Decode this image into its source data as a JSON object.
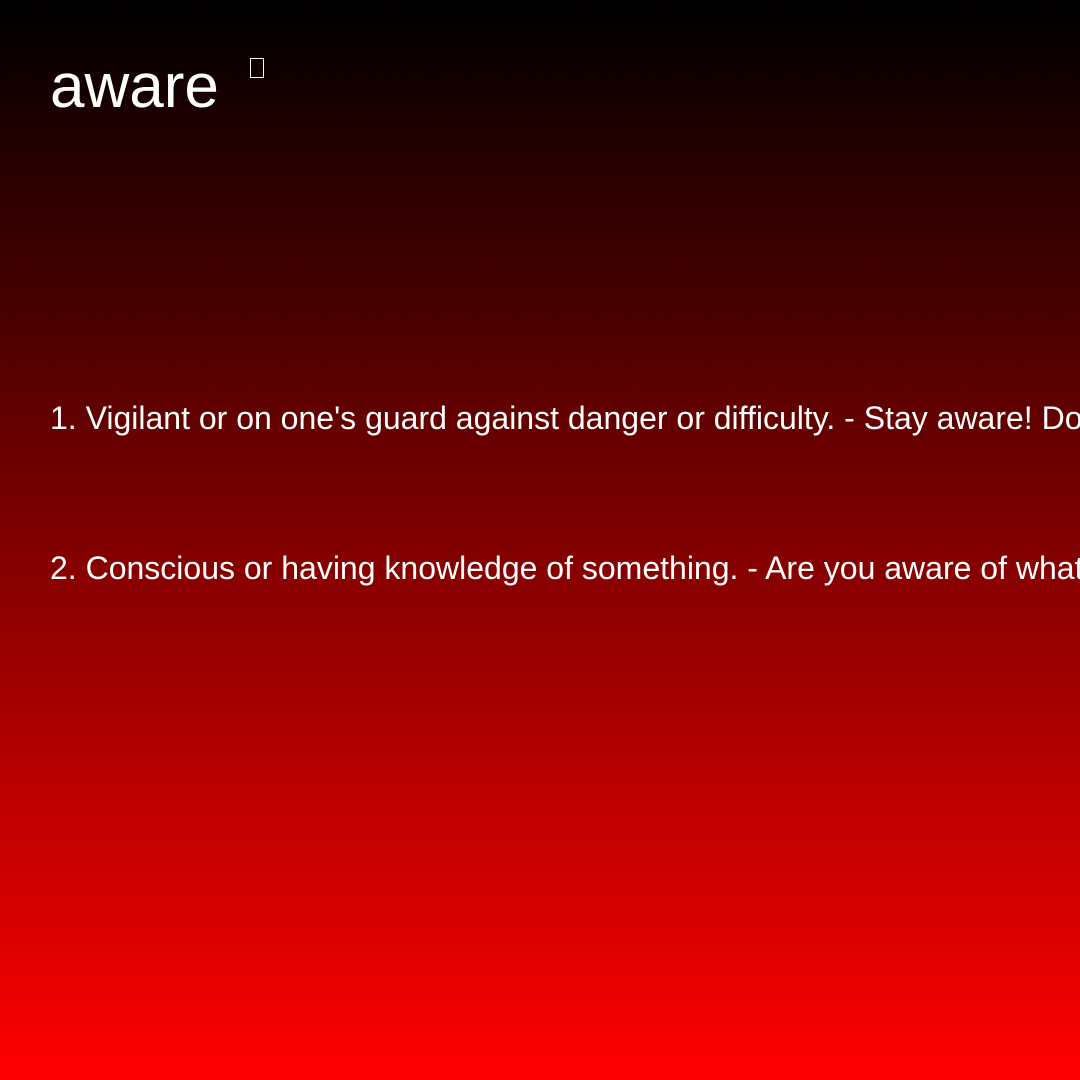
{
  "word": "aware",
  "icons": {
    "title_icon": "missing-glyph-icon"
  },
  "definitions": [
    {
      "text": "1. Vigilant or on one's guard against danger or difficulty. - Stay aware! Do"
    },
    {
      "text": "2. Conscious or having knowledge of something. - Are you aware of what"
    }
  ],
  "colors": {
    "gradient_top": "#000000",
    "gradient_bottom": "#ff0000",
    "text": "#ffffff"
  }
}
